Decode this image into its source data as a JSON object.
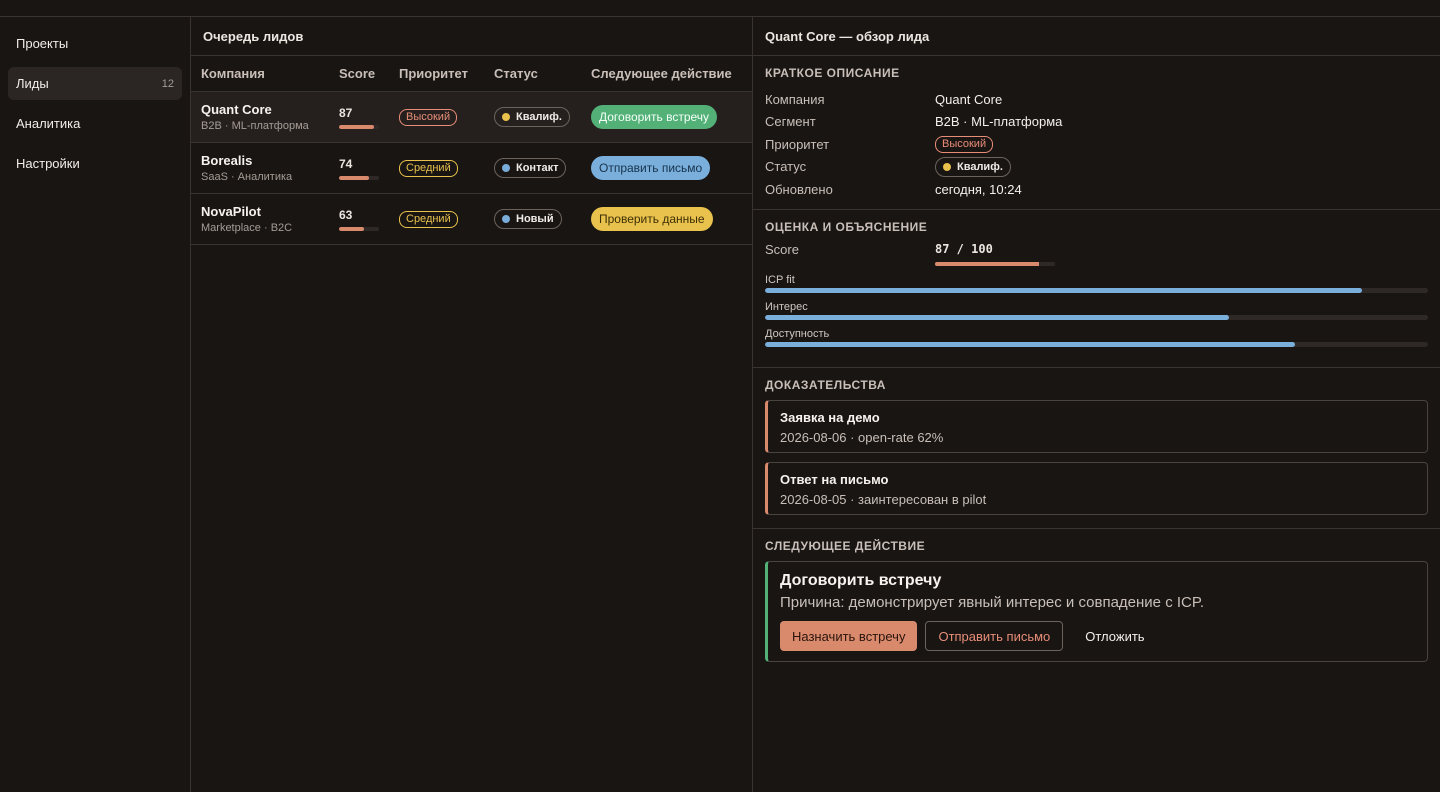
{
  "sidebar": {
    "items": [
      {
        "label": "Проекты"
      },
      {
        "label": "Лиды",
        "count": "12"
      },
      {
        "label": "Аналитика"
      },
      {
        "label": "Настройки"
      }
    ]
  },
  "queue": {
    "title": "Очередь лидов",
    "columns": [
      "Компания",
      "Score",
      "Приоритет",
      "Статус",
      "Следующее действие"
    ],
    "rows": [
      {
        "company": "Quant Core",
        "sub": "B2B · ML-платформа",
        "score": "87",
        "score_value": 87,
        "priority": "Высокий",
        "status": "Квалиф.",
        "action": "Договорить встречу"
      },
      {
        "company": "Borealis",
        "sub": "SaaS · Аналитика",
        "score": "74",
        "score_value": 74,
        "priority": "Средний",
        "status": "Контакт",
        "action": "Отправить письмо"
      },
      {
        "company": "NovaPilot",
        "sub": "Marketplace · B2C",
        "score": "63",
        "score_value": 63,
        "priority": "Средний",
        "status": "Новый",
        "action": "Проверить данные"
      }
    ]
  },
  "detail": {
    "title": "Quant Core — обзор лида",
    "summary": {
      "heading": "КРАТКОЕ ОПИСАНИЕ",
      "company_label": "Компания",
      "company": "Quant Core",
      "segment_label": "Сегмент",
      "segment": "B2B · ML-платформа",
      "priority_label": "Приоритет",
      "priority": "Высокий",
      "status_label": "Статус",
      "status": "Квалиф.",
      "updated_label": "Обновлено",
      "updated": "сегодня, 10:24"
    },
    "scoring": {
      "heading": "ОЦЕНКА И ОБЪЯСНЕНИЕ",
      "score_label": "Score",
      "score_text": "87 / 100",
      "score_value": 87,
      "factors": [
        {
          "label": "ICP fit",
          "value": 90
        },
        {
          "label": "Интерес",
          "value": 70
        },
        {
          "label": "Доступность",
          "value": 80
        }
      ]
    },
    "evidence": {
      "heading": "ДОКАЗАТЕЛЬСТВА",
      "items": [
        {
          "title": "Заявка на демо",
          "sub": "2026-08-06 · open-rate 62%"
        },
        {
          "title": "Ответ на письмо",
          "sub": "2026-08-05 · заинтересован в pilot"
        }
      ]
    },
    "next": {
      "heading": "СЛЕДУЮЩЕЕ ДЕЙСТВИЕ",
      "title": "Договорить встречу",
      "reason": "Причина: демонстрирует явный интерес и совпадение с ICP.",
      "primary": "Назначить встречу",
      "secondary": "Отправить письмо",
      "tertiary": "Отложить"
    }
  },
  "colors": {
    "accent": "#d98a6d",
    "green": "#53b178",
    "blue": "#7aafdc",
    "yellow": "#e9c14d"
  }
}
